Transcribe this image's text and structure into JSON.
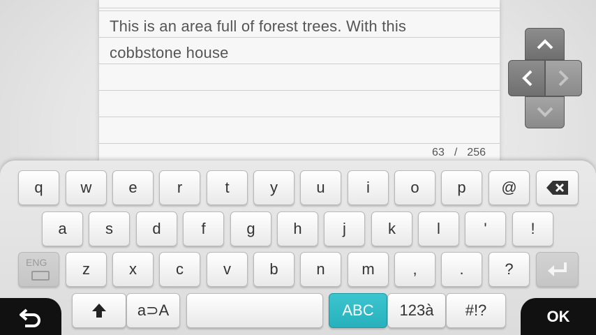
{
  "editor": {
    "text_line1": "This is an area full of forest trees. With this",
    "text_line2": "cobbstone house",
    "char_count": "63",
    "separator": "/",
    "char_max": "256"
  },
  "dpad": {
    "up": "^",
    "left": "<",
    "right": ">",
    "down": "v"
  },
  "keyboard": {
    "row1": [
      "q",
      "w",
      "e",
      "r",
      "t",
      "y",
      "u",
      "i",
      "o",
      "p",
      "@"
    ],
    "backspace_icon": "backspace-icon",
    "row2": [
      "a",
      "s",
      "d",
      "f",
      "g",
      "h",
      "j",
      "k",
      "l",
      "'",
      "!"
    ],
    "eng_label": "ENG",
    "row3": [
      "z",
      "x",
      "c",
      "v",
      "b",
      "n",
      "m",
      ",",
      ".",
      "?"
    ],
    "enter_icon": "enter-icon",
    "shift_icon": "shift-arrow-icon",
    "case_toggle": "a⊃A",
    "space": "",
    "mode_abc": "ABC",
    "mode_num": "123à",
    "mode_sym": "#!?"
  },
  "bottom": {
    "back_icon": "back-arrow-icon",
    "ok": "OK"
  },
  "colors": {
    "accent": "#2fbac4",
    "dark": "#111111"
  }
}
